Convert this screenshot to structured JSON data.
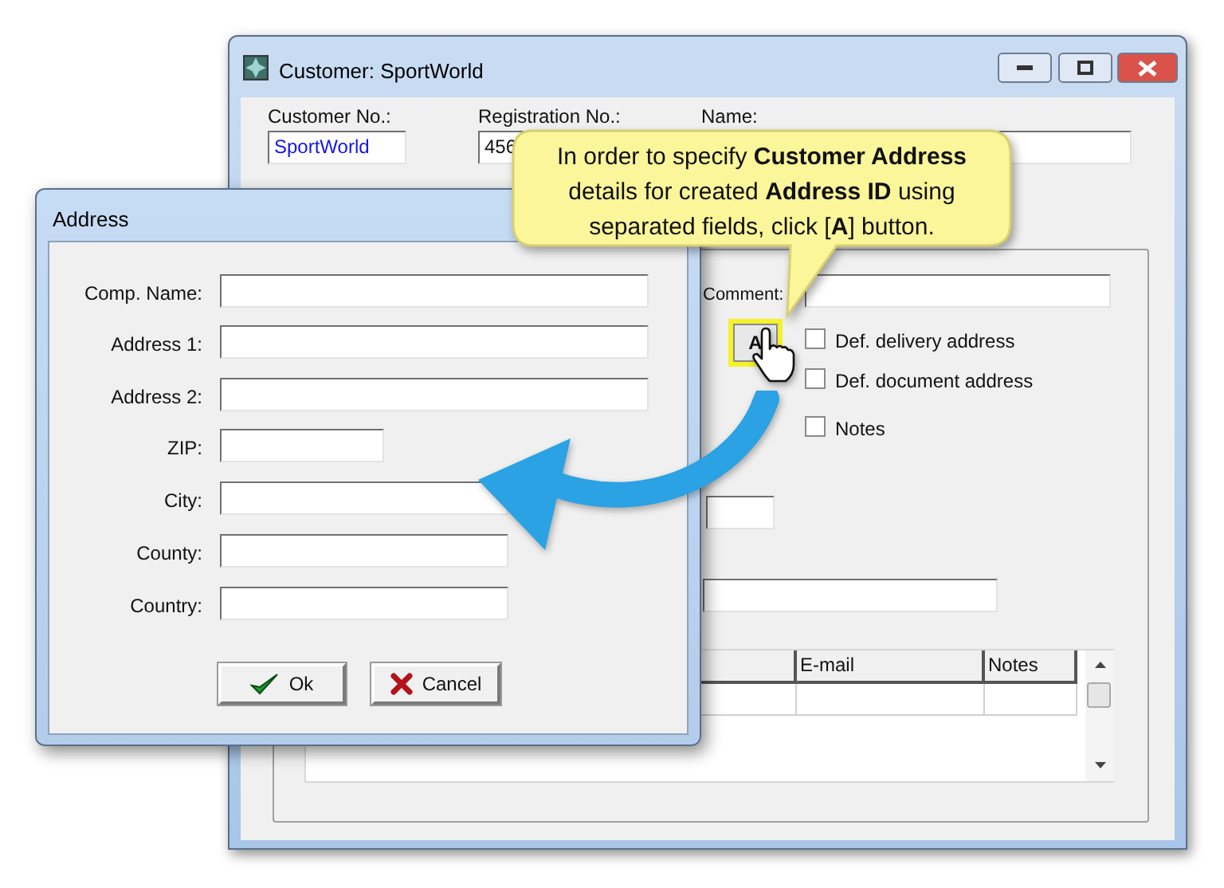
{
  "customer_window": {
    "title": "Customer: SportWorld",
    "fields": [
      {
        "label": "Customer No.:",
        "value": "SportWorld"
      },
      {
        "label": "Registration No.:",
        "value": "456"
      },
      {
        "label": "Name:"
      }
    ],
    "comment_label": "Comment:",
    "address_button": "A",
    "checkboxes": [
      {
        "label": "Def. delivery address",
        "checked": false
      },
      {
        "label": "Def. document address",
        "checked": false
      },
      {
        "label": "Notes",
        "checked": false
      }
    ],
    "table": {
      "columns": [
        "E-mail",
        "Notes"
      ]
    }
  },
  "address_dialog": {
    "title": "Address",
    "fields": [
      {
        "label": "Comp. Name:"
      },
      {
        "label": "Address 1:"
      },
      {
        "label": "Address 2:"
      },
      {
        "label": "ZIP:"
      },
      {
        "label": "City:"
      },
      {
        "label": "County:"
      },
      {
        "label": "Country:"
      }
    ],
    "buttons": [
      {
        "label": "Ok",
        "kind": "ok"
      },
      {
        "label": "Cancel",
        "kind": "cancel"
      }
    ]
  },
  "callout": {
    "text": "In order to specify **Customer Address** details for created **Address ID** using separated fields, click [**A**] button."
  }
}
